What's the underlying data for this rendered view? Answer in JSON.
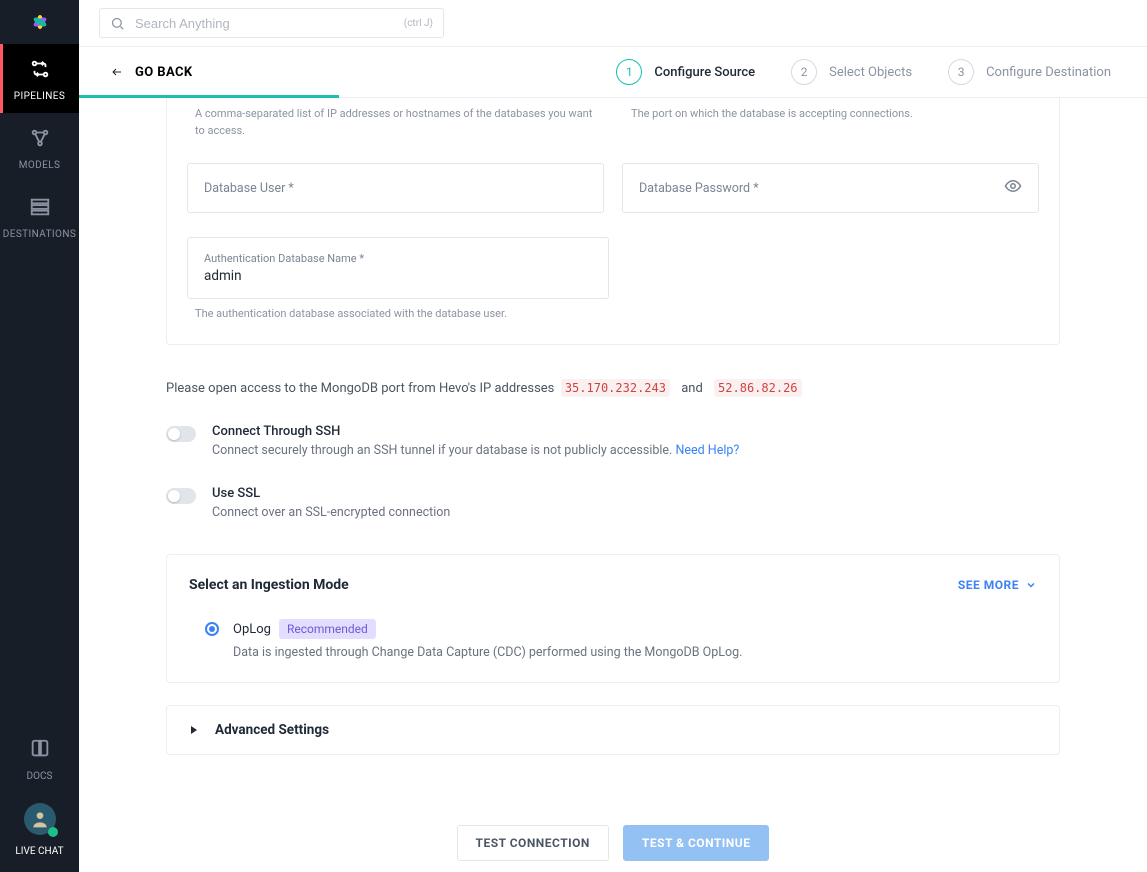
{
  "sidebar": {
    "items": [
      {
        "label": "PIPELINES"
      },
      {
        "label": "MODELS"
      },
      {
        "label": "DESTINATIONS"
      }
    ],
    "docs": "DOCS",
    "chat": "LIVE CHAT"
  },
  "search": {
    "placeholder": "Search Anything",
    "shortcut": "(ctrl J)"
  },
  "goBack": "GO BACK",
  "steps": [
    {
      "num": "1",
      "label": "Configure Source"
    },
    {
      "num": "2",
      "label": "Select Objects"
    },
    {
      "num": "3",
      "label": "Configure Destination"
    }
  ],
  "helpers": {
    "host": "A comma-separated list of IP addresses or hostnames of the databases you want to access.",
    "port": "The port on which the database is accepting connections."
  },
  "fields": {
    "dbUser": "Database User *",
    "dbPassword": "Database Password *",
    "authDbLabel": "Authentication Database Name *",
    "authDbValue": "admin",
    "authDbHelper": "The authentication database associated with the database user."
  },
  "ipNote": {
    "prefix": "Please open access to the MongoDB port from Hevo's IP addresses",
    "ip1": "35.170.232.243",
    "and": "and",
    "ip2": "52.86.82.26"
  },
  "ssh": {
    "title": "Connect Through SSH",
    "desc": "Connect securely through an SSH tunnel if your database is not publicly accessible.",
    "help": "Need Help?"
  },
  "ssl": {
    "title": "Use SSL",
    "desc": "Connect over an SSL-encrypted connection"
  },
  "ingestion": {
    "heading": "Select an Ingestion Mode",
    "seeMore": "SEE MORE",
    "optTitle": "OpLog",
    "optBadge": "Recommended",
    "optDesc": "Data is ingested through Change Data Capture (CDC) performed using the MongoDB OpLog."
  },
  "advanced": "Advanced Settings",
  "buttons": {
    "test": "TEST CONNECTION",
    "continue": "TEST & CONTINUE"
  }
}
